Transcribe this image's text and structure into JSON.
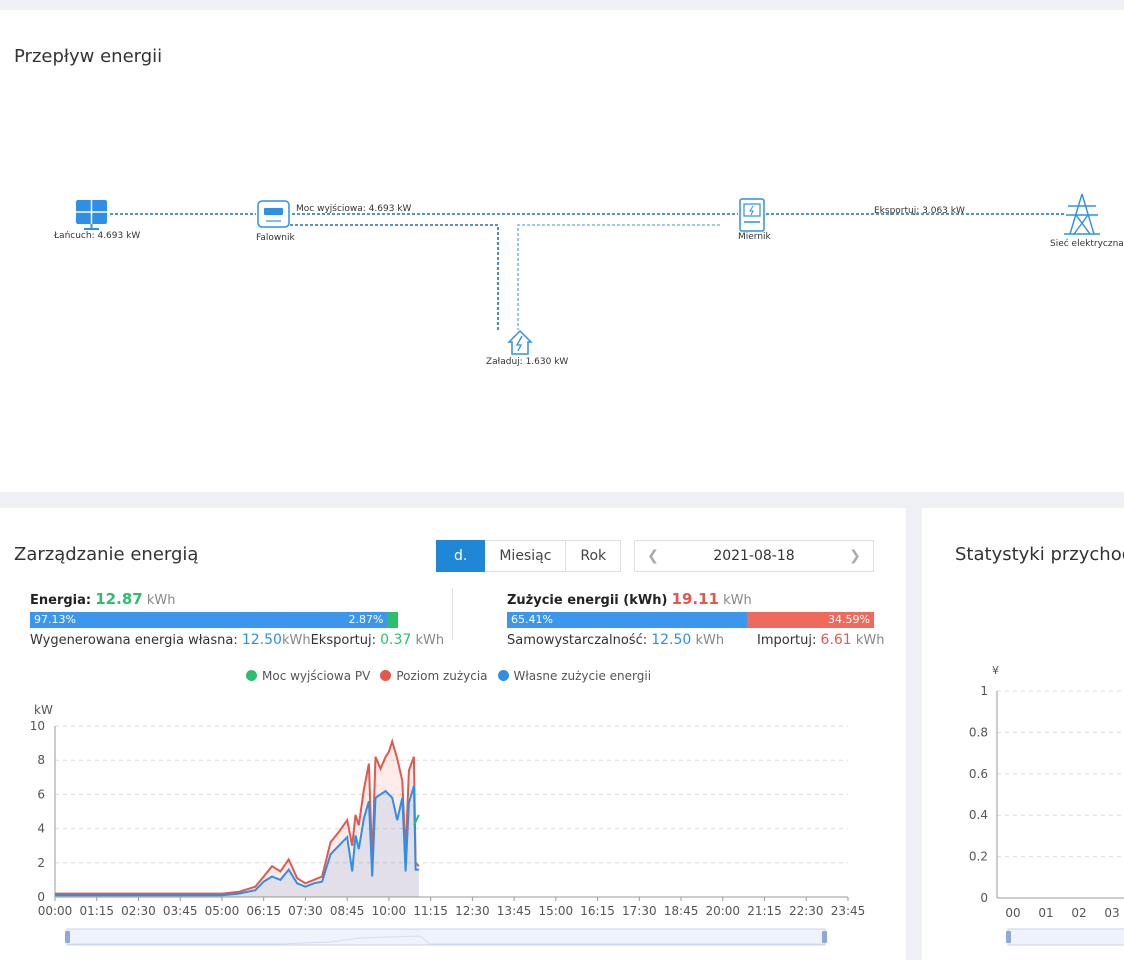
{
  "flow": {
    "title": "Przepływ energii",
    "nodes": {
      "string": {
        "label": "Łańcuch: 4.693 kW",
        "icon": "solar-panel-icon"
      },
      "inverter": {
        "label": "Falownik",
        "icon": "inverter-icon"
      },
      "meter": {
        "label": "Miernik",
        "icon": "meter-icon"
      },
      "grid": {
        "label": "Sieć elektryczna",
        "icon": "power-tower-icon"
      },
      "load": {
        "label": "Załaduj: 1.630 kW",
        "icon": "house-bolt-icon"
      }
    },
    "output_label": "Moc wyjściowa: 4.693 kW",
    "export_label": "Eksportuj: 3.063 kW"
  },
  "energy": {
    "title": "Zarządzanie energią",
    "tabs": [
      "d.",
      "Miesiąc",
      "Rok"
    ],
    "active_tab": 0,
    "date": "2021-08-18",
    "left": {
      "label": "Energia:",
      "value": "12.87",
      "unit": "kWh",
      "bar_blue_pct": "97.13%",
      "bar_green_pct": "2.87%",
      "bar_blue_fraction": 0.9713,
      "self_label": "Wygenerowana energia własna:",
      "self_value": "12.50",
      "self_unit": "kWh",
      "export_label": "Eksportuj:",
      "export_value": "0.37",
      "export_unit": "kWh"
    },
    "right": {
      "label": "Zużycie energii (kWh)",
      "value": "19.11",
      "unit": "kWh",
      "bar_blue_pct": "65.41%",
      "bar_red_pct": "34.59%",
      "bar_blue_fraction": 0.6541,
      "self_label": "Samowystarczalność:",
      "self_value": "12.50",
      "self_unit": "kWh",
      "import_label": "Importuj:",
      "import_value": "6.61",
      "import_unit": "kWh"
    },
    "legend": [
      "Moc wyjściowa PV",
      "Poziom zużycia",
      "Własne zużycie energii"
    ],
    "colors": {
      "pv": "#2dbe6c",
      "consumption": "#e5574b",
      "self": "#2f8fe6"
    }
  },
  "stats": {
    "title": "Statystyki przychodów"
  },
  "chart_data": [
    {
      "type": "line",
      "ylabel": "kW",
      "ylim": [
        0,
        10
      ],
      "yticks": [
        0,
        2,
        4,
        6,
        8,
        10
      ],
      "xticks": [
        "00:00",
        "01:15",
        "02:30",
        "03:45",
        "05:00",
        "06:15",
        "07:30",
        "08:45",
        "10:00",
        "11:15",
        "12:30",
        "13:45",
        "15:00",
        "16:15",
        "17:30",
        "18:45",
        "20:00",
        "21:15",
        "22:30",
        "23:45"
      ],
      "grid": true,
      "legend_position": "top",
      "x_unit": "hours",
      "series": [
        {
          "name": "Poziom zużycia",
          "color": "#e5574b",
          "x": [
            0,
            1,
            2,
            3,
            4,
            5,
            5.5,
            6,
            6.25,
            6.5,
            6.75,
            7,
            7.25,
            7.5,
            7.75,
            8,
            8.25,
            8.5,
            8.75,
            8.9,
            9,
            9.1,
            9.25,
            9.4,
            9.5,
            9.6,
            9.75,
            9.9,
            10,
            10.1,
            10.25,
            10.4,
            10.5,
            10.6,
            10.75,
            10.8,
            10.9
          ],
          "y": [
            0.2,
            0.2,
            0.2,
            0.2,
            0.2,
            0.2,
            0.3,
            0.6,
            1.2,
            1.8,
            1.5,
            2.2,
            1.1,
            0.8,
            1.0,
            1.2,
            3.2,
            3.8,
            4.5,
            3.0,
            4.8,
            4.2,
            6.3,
            7.8,
            2.0,
            8.2,
            7.5,
            8.2,
            8.5,
            9.1,
            8.1,
            6.8,
            2.5,
            7.4,
            8.2,
            2.0,
            1.8
          ]
        },
        {
          "name": "Własne zużycie energii",
          "color": "#2f8fe6",
          "x": [
            0,
            1,
            2,
            3,
            4,
            5,
            5.5,
            6,
            6.25,
            6.5,
            6.75,
            7,
            7.25,
            7.5,
            7.75,
            8,
            8.25,
            8.5,
            8.75,
            8.9,
            9,
            9.1,
            9.25,
            9.4,
            9.5,
            9.6,
            9.75,
            9.9,
            10,
            10.1,
            10.25,
            10.4,
            10.5,
            10.6,
            10.75,
            10.8,
            10.9
          ],
          "y": [
            0.1,
            0.1,
            0.1,
            0.1,
            0.1,
            0.1,
            0.2,
            0.4,
            0.9,
            1.2,
            1.0,
            1.6,
            0.8,
            0.6,
            0.8,
            0.9,
            2.5,
            3.0,
            3.5,
            1.5,
            3.6,
            2.8,
            4.6,
            5.6,
            1.2,
            5.8,
            6.0,
            6.2,
            6.0,
            5.8,
            4.5,
            5.8,
            1.5,
            5.5,
            6.5,
            1.6,
            1.6
          ]
        },
        {
          "name": "Moc wyjściowa PV",
          "color": "#2dbe6c",
          "x": [
            10.75,
            10.9
          ],
          "y": [
            4.2,
            4.8
          ]
        }
      ]
    },
    {
      "type": "bar",
      "ylabel": "¥",
      "ylim": [
        0,
        1
      ],
      "yticks": [
        0,
        0.2,
        0.4,
        0.6,
        0.8,
        1
      ],
      "categories": [
        "00",
        "01",
        "02",
        "03"
      ],
      "values": [],
      "grid": true
    }
  ]
}
